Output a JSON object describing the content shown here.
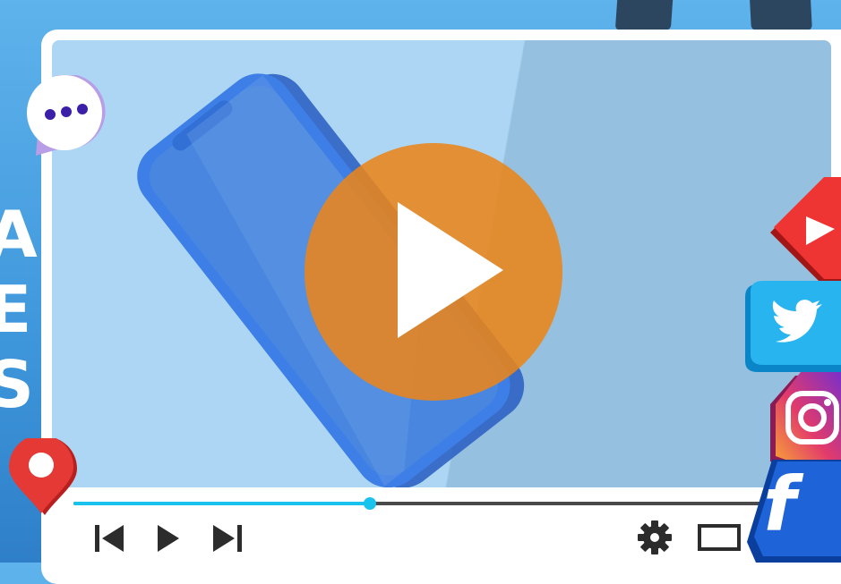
{
  "background": {
    "side_letters": [
      "A",
      "E",
      "S"
    ]
  },
  "player": {
    "progress": 0.43,
    "controls": {
      "previous_icon": "skip-previous-icon",
      "play_icon": "play-icon",
      "next_icon": "skip-next-icon",
      "settings_icon": "gear-icon",
      "theater_icon": "theater-mode-icon"
    },
    "big_play_icon": "play-circle-icon"
  },
  "decorations": {
    "chat_icon": "chat-bubble-icon",
    "pin_icon": "location-pin-icon",
    "social_icons": [
      "youtube-icon",
      "twitter-icon",
      "instagram-icon",
      "facebook-icon"
    ],
    "facebook_letter": "f"
  },
  "colors": {
    "accent_play": "#eb851a",
    "progress": "#19c3ee",
    "phone": "#3d7fe6"
  }
}
